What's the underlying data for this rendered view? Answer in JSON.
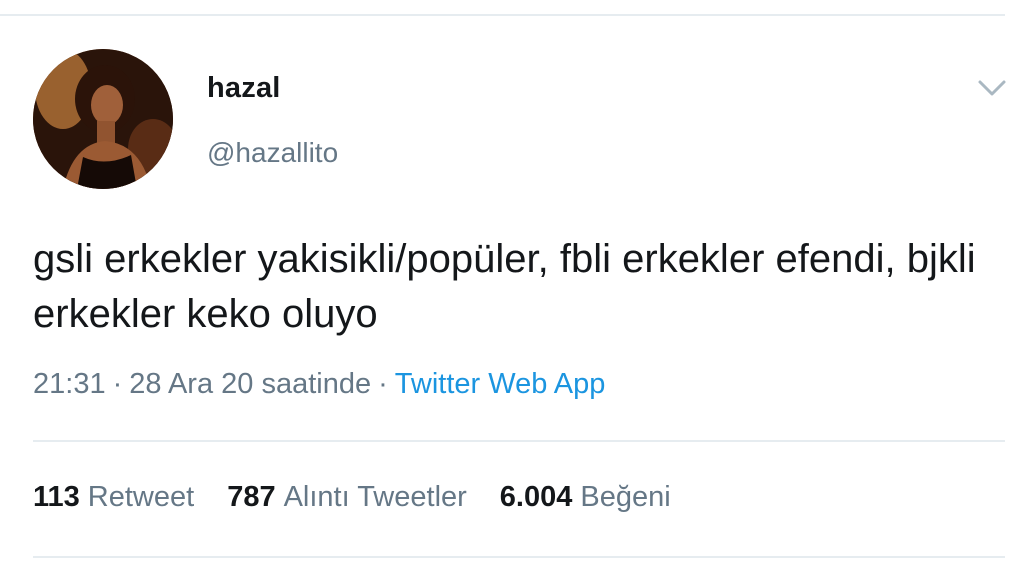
{
  "user": {
    "display_name": "hazal",
    "handle": "@hazallito",
    "avatar_icon": "profile-photo"
  },
  "tweet": {
    "text": "gsli erkekler yakisikli/popüler, fbli erkekler efendi, bjkli erkekler keko oluyo",
    "time": "21:31",
    "date": "28 Ara 20 saatinde",
    "separator": "·",
    "source": "Twitter Web App"
  },
  "stats": {
    "retweets": {
      "count": "113",
      "label": "Retweet"
    },
    "quotes": {
      "count": "787",
      "label": "Alıntı Tweetler"
    },
    "likes": {
      "count": "6.004",
      "label": "Beğeni"
    }
  },
  "colors": {
    "text": "#14171a",
    "secondary": "#657786",
    "link": "#1b95e0",
    "divider": "#e6ecf0"
  },
  "icons": {
    "menu": "chevron-down-icon"
  }
}
